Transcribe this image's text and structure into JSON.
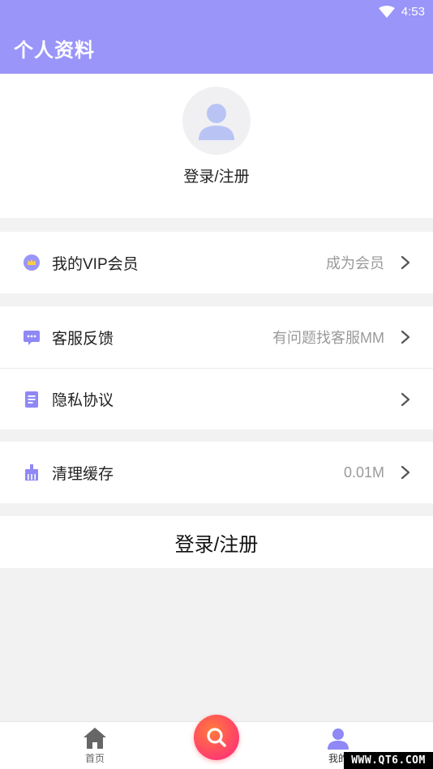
{
  "status_bar": {
    "time": "4:53"
  },
  "header": {
    "title": "个人资料"
  },
  "profile": {
    "login_label": "登录/注册"
  },
  "menu": {
    "vip": {
      "label": "我的VIP会员",
      "value": "成为会员"
    },
    "feedback": {
      "label": "客服反馈",
      "value": "有问题找客服MM"
    },
    "privacy": {
      "label": "隐私协议",
      "value": ""
    },
    "cache": {
      "label": "清理缓存",
      "value": "0.01M"
    }
  },
  "login_button": {
    "label": "登录/注册"
  },
  "tabbar": {
    "home_label": "首页",
    "mine_label": "我的"
  },
  "watermark": {
    "text": "WWW.QT6.COM"
  },
  "colors": {
    "accent": "#9a95f9",
    "fab": "#ff4d5e"
  }
}
